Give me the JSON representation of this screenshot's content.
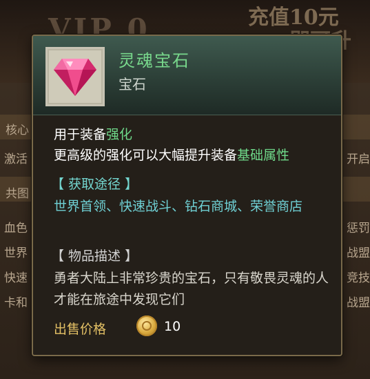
{
  "background": {
    "vip_label": "VIP 0",
    "recharge_line1": "充值10元",
    "recharge_line2": "即可升",
    "rows_left": [
      "核心",
      "激活",
      "共图",
      "血色",
      "世界",
      "快速",
      "卡和"
    ],
    "rows_right": [
      "开启",
      "惩罚",
      "战盟",
      "竞技",
      "战盟"
    ]
  },
  "tooltip": {
    "item_name": "灵魂宝石",
    "item_type": "宝石",
    "icon": "pink-gem-icon",
    "usage_line1_prefix": "用于装备",
    "usage_line1_highlight": "强化",
    "usage_line2_prefix": "更高级的强化可以大幅提升装备",
    "usage_line2_highlight": "基础属性",
    "acquire_title": "【 获取途径 】",
    "acquire_text": "世界首领、快速战斗、钻石商城、荣誉商店",
    "desc_title": "【 物品描述 】",
    "desc_text": "勇者大陆上非常珍贵的宝石，只有敬畏灵魂的人才能在旅途中发现它们",
    "price_label": "出售价格",
    "price_icon": "gold-coin-icon",
    "price_value": "10"
  },
  "colors": {
    "item_name": "#78d88c",
    "highlight": "#6fd98a",
    "acquire": "#74d6d0",
    "price_label": "#e3c065"
  }
}
